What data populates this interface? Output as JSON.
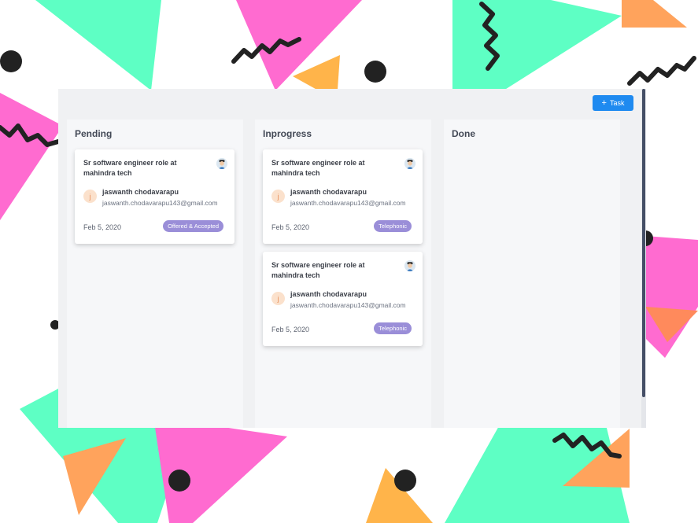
{
  "toolbar": {
    "add_task_label": "Task",
    "add_task_icon": "plus-icon"
  },
  "colors": {
    "accent": "#1e8af0",
    "badge": "#9a8ed8",
    "candidate_avatar": "#fbe1cc"
  },
  "columns": [
    {
      "title": "Pending",
      "cards": [
        {
          "title": "Sr software engineer role at mahindra tech",
          "candidate_initial": "j",
          "candidate_name": "jaswanth chodavarapu",
          "candidate_email": "jaswanth.chodavarapu143@gmail.com",
          "date": "Feb 5, 2020",
          "status": "Offered & Accepted"
        }
      ]
    },
    {
      "title": "Inprogress",
      "cards": [
        {
          "title": "Sr software engineer role at mahindra tech",
          "candidate_initial": "j",
          "candidate_name": "jaswanth chodavarapu",
          "candidate_email": "jaswanth.chodavarapu143@gmail.com",
          "date": "Feb 5, 2020",
          "status": "Telephonic"
        },
        {
          "title": "Sr software engineer role at mahindra tech",
          "candidate_initial": "j",
          "candidate_name": "jaswanth chodavarapu",
          "candidate_email": "jaswanth.chodavarapu143@gmail.com",
          "date": "Feb 5, 2020",
          "status": "Telephonic"
        }
      ]
    },
    {
      "title": "Done",
      "cards": []
    }
  ]
}
